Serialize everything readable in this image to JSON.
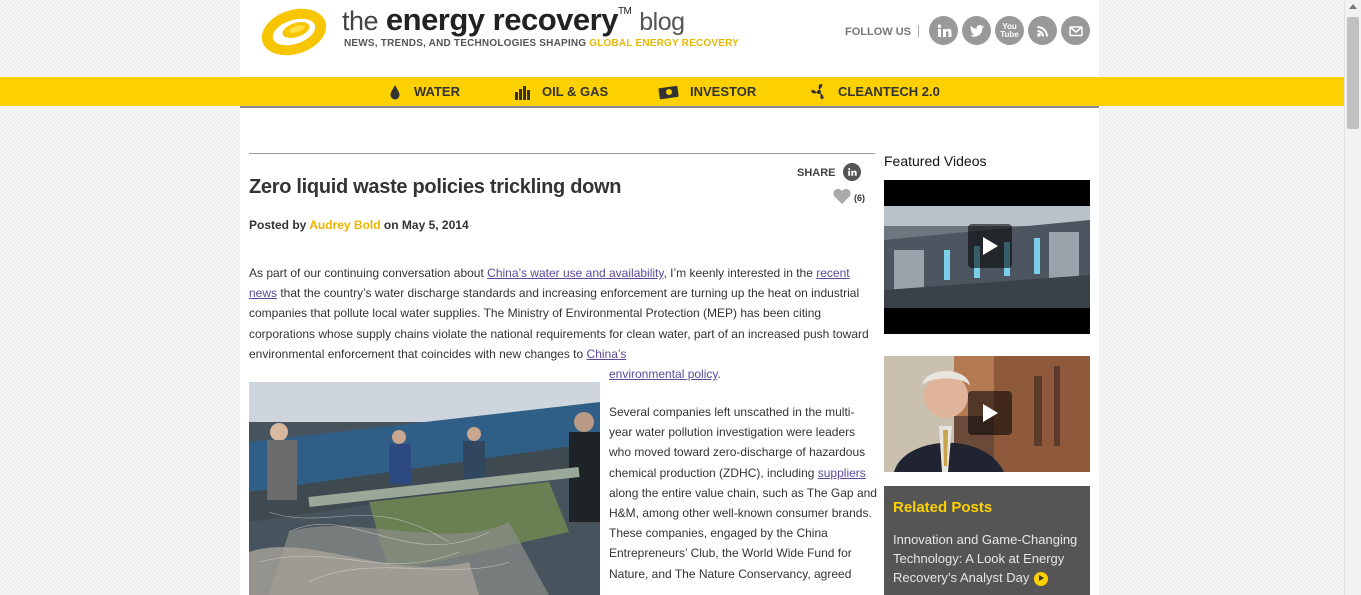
{
  "header": {
    "logo_the": "the",
    "logo_brand": "energy recovery",
    "logo_tm": "TM",
    "logo_blog": "blog",
    "tagline_main": "NEWS, TRENDS, AND TECHNOLOGIES SHAPING ",
    "tagline_highlight": "GLOBAL ENERGY RECOVERY",
    "follow_label": "FOLLOW US",
    "social": [
      "linkedin-icon",
      "twitter-icon",
      "youtube-icon",
      "rss-icon",
      "email-icon"
    ],
    "youtube_text": "You\nTube"
  },
  "nav": {
    "items": [
      {
        "label": "WATER",
        "icon": "water-drop-icon"
      },
      {
        "label": "OIL & GAS",
        "icon": "oil-rig-icon"
      },
      {
        "label": "INVESTOR",
        "icon": "money-icon"
      },
      {
        "label": "CLEANTECH 2.0",
        "icon": "fan-icon"
      }
    ]
  },
  "article": {
    "title": "Zero liquid waste policies trickling down",
    "share_label": "SHARE",
    "like_count": "(6)",
    "byline_prefix": "Posted by ",
    "author": "Audrey Bold",
    "byline_mid": " on ",
    "date": "May 5, 2014",
    "p1_a": "As part of our continuing conversation about ",
    "p1_link1": "China’s water use and availability",
    "p1_b": ", I’m keenly interested in the ",
    "p1_link2": "recent news",
    "p1_c": " that the country’s water discharge standards and increasing enforcement are turning up the heat on industrial companies that pollute local water supplies. The Ministry of Environmental Protection (MEP) has been citing corporations whose supply chains violate the national requirements for clean water, part of an increased push toward environmental enforcement that coincides with new changes to ",
    "p1_link3a": "China’s",
    "p1_link3b": "environmental policy",
    "p1_end": ".",
    "p2_a": "Several companies left unscathed in the multi-year water pollution investigation were leaders who moved toward zero-discharge of hazardous chemical production (ZDHC), including ",
    "p2_link": "suppliers",
    "p2_b": " along the entire value chain, such as The Gap and H&M, among other well-known consumer brands. These companies, engaged by the China Entrepreneurs’ Club, the World Wide Fund for Nature, and The Nature Conservancy, agreed"
  },
  "sidebar": {
    "featured_title": "Featured Videos",
    "related_title": "Related Posts",
    "related_item": "Innovation and Game-Changing Technology: A Look at Energy Recovery’s Analyst Day"
  },
  "colors": {
    "accent_yellow": "#fdd100",
    "author_gold": "#f0b400",
    "link_purple": "#5a4a9c",
    "related_bg": "#555555"
  }
}
